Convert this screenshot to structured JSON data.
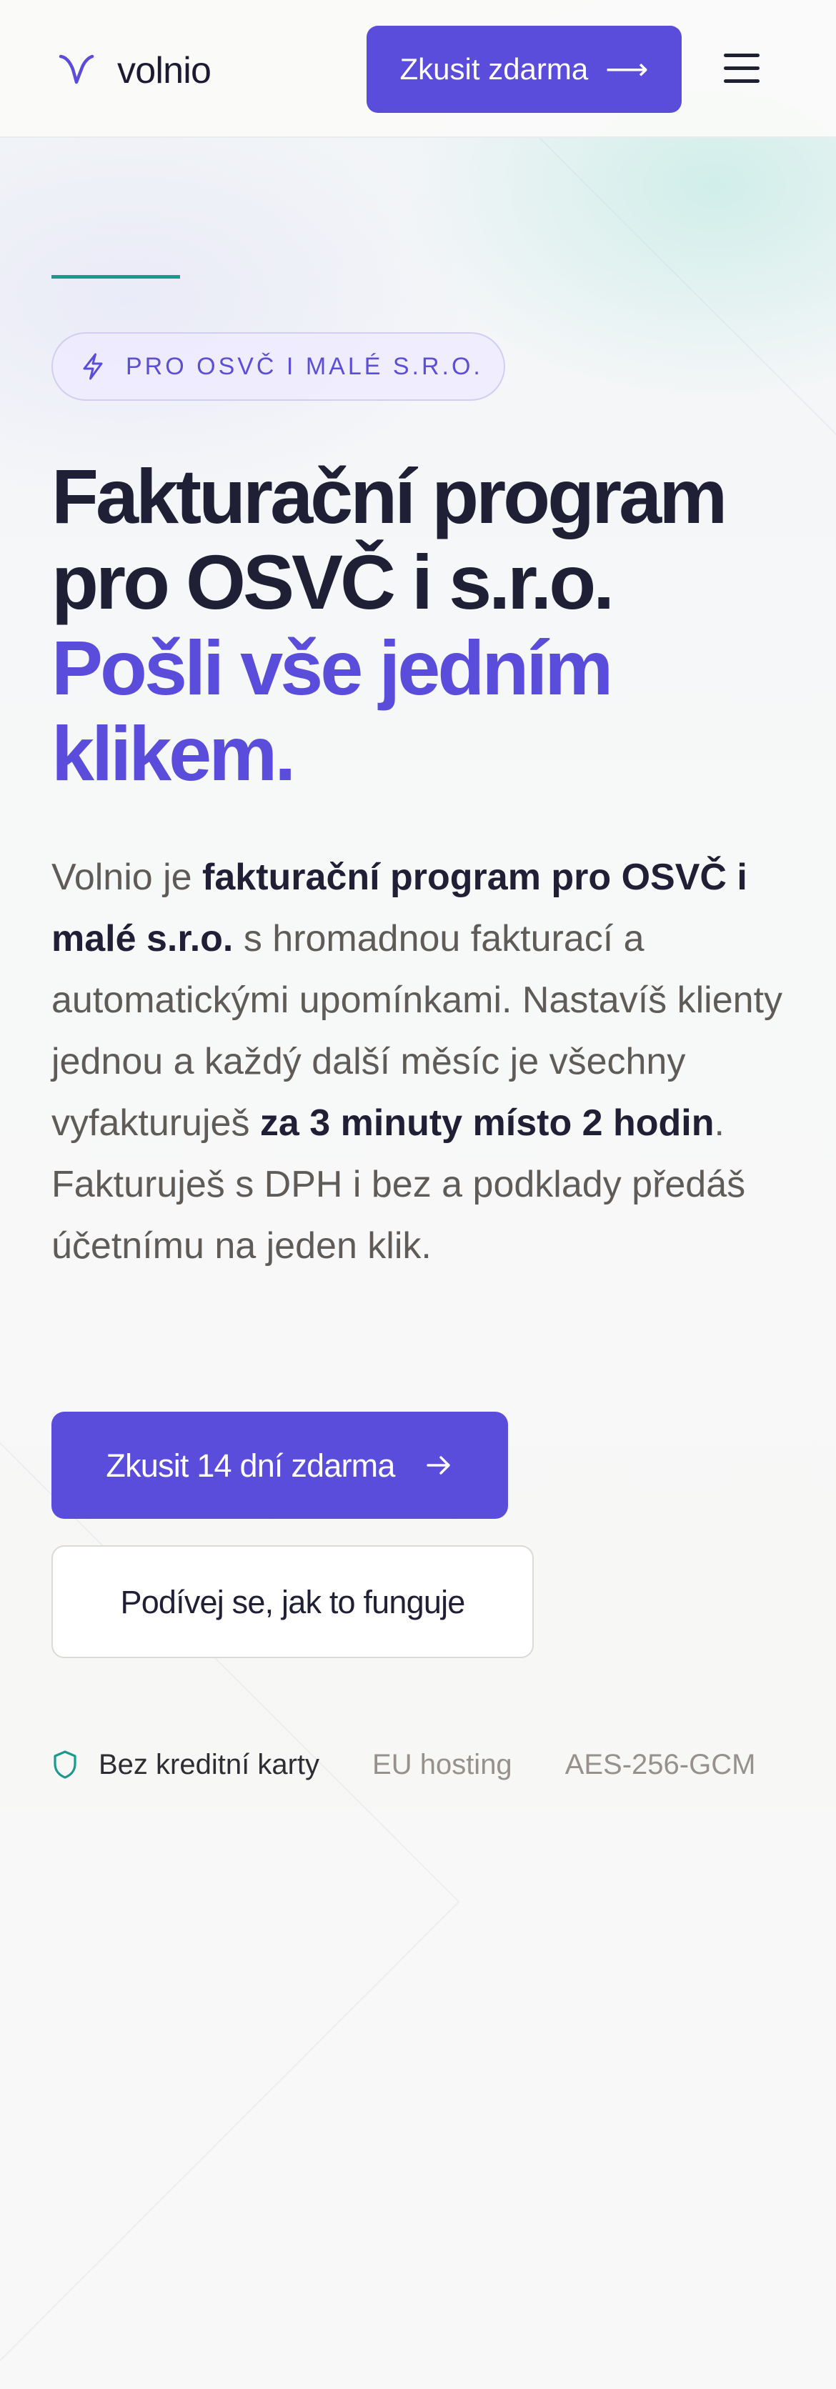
{
  "brand": {
    "logo_icon": "volnio-v-logo-icon",
    "name": "volnio",
    "primary_color": "#5A4DDC",
    "accent_color": "#1A9A8D"
  },
  "header": {
    "cta_label": "Zkusit zdarma",
    "cta_arrow_icon": "arrow-right-icon",
    "menu_icon": "hamburger-menu-icon"
  },
  "hero": {
    "badge_icon": "lightning-icon",
    "badge_text": "PRO OSVČ I MALÉ S.R.O.",
    "title": {
      "line_1": "Fakturační program",
      "line_2": "pro OSVČ i s.r.o.",
      "highlight_line_1": "Pošli vše jedním",
      "highlight_line_2": "klikem."
    },
    "description": {
      "part_1": "Volnio je ",
      "strong_1": "fakturační program pro OSVČ i malé s.r.o.",
      "part_2": " s hromadnou fakturací a automatickými upomínkami. Nastavíš klienty jednou a každý další měsíc je všechny vyfakturuješ ",
      "strong_2": "za 3 minuty místo 2 hodin",
      "part_3": ". Fakturuješ s DPH i bez a podklady předáš účetnímu na jeden klik."
    },
    "primary_cta": {
      "label": "Zkusit 14 dní zdarma",
      "icon": "arrow-right-icon"
    },
    "secondary_cta": {
      "label": "Podívej se, jak to funguje"
    },
    "trust": {
      "shield_icon": "shield-icon",
      "items": [
        "Bez kreditní karty",
        "EU hosting",
        "AES-256-GCM"
      ]
    }
  }
}
